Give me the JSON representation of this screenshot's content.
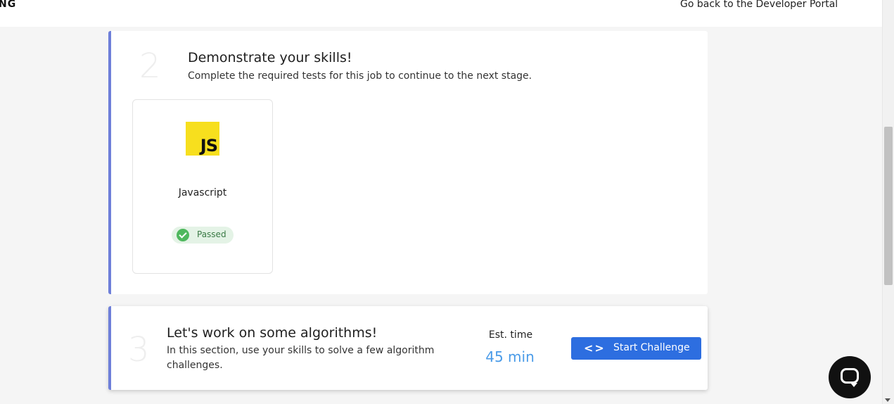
{
  "header": {
    "brand": "NG",
    "portal_link": "Go back to the Developer Portal"
  },
  "step2": {
    "number": "2",
    "title": "Demonstrate your skills!",
    "subtitle": "Complete the required tests for this job to continue to the next stage.",
    "skills": [
      {
        "logo_text": "JS",
        "name": "Javascript",
        "status": "Passed"
      }
    ]
  },
  "step3": {
    "number": "3",
    "title": "Let's work on some algorithms!",
    "subtitle": "In this section, use your skills to solve a few algorithm challenges.",
    "est_label": "Est. time",
    "est_value": "45 min",
    "button_label": "Start Challenge"
  },
  "icons": {
    "code_icon": "code-brackets-icon",
    "check_icon": "check-circle-icon",
    "chat_icon": "chat-bubble-icon"
  },
  "colors": {
    "accent_border": "#6e7fd9",
    "button": "#2d6ee0",
    "est_value": "#4a9be8",
    "passed_badge": "#e4f3e6",
    "js_yellow": "#f7df1e"
  }
}
